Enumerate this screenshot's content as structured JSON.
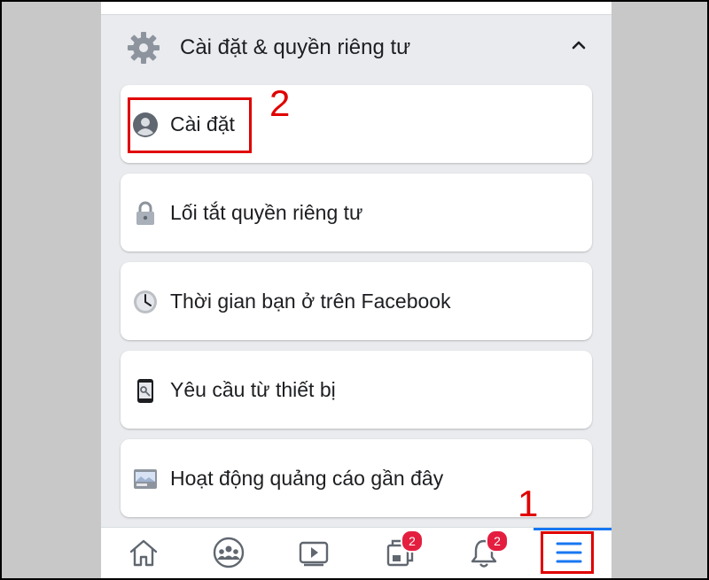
{
  "section": {
    "title": "Cài đặt & quyền riêng tư",
    "icon": "gear-icon",
    "collapse_icon": "chevron-up-icon"
  },
  "menu": [
    {
      "label": "Cài đặt",
      "icon": "user-avatar-icon"
    },
    {
      "label": "Lối tắt quyền riêng tư",
      "icon": "lock-icon"
    },
    {
      "label": "Thời gian bạn ở trên Facebook",
      "icon": "clock-icon"
    },
    {
      "label": "Yêu cầu từ thiết bị",
      "icon": "phone-key-icon"
    },
    {
      "label": "Hoạt động quảng cáo gần đây",
      "icon": "ad-activity-icon"
    }
  ],
  "tabbar": {
    "tabs": [
      {
        "name": "home",
        "icon": "home-icon"
      },
      {
        "name": "groups",
        "icon": "groups-icon"
      },
      {
        "name": "watch",
        "icon": "video-icon"
      },
      {
        "name": "pages",
        "icon": "pages-icon",
        "badge": "2"
      },
      {
        "name": "notifications",
        "icon": "bell-icon",
        "badge": "2"
      },
      {
        "name": "menu",
        "icon": "hamburger-menu-icon",
        "active": true
      }
    ]
  },
  "annotations": {
    "step1": "1",
    "step2": "2"
  },
  "colors": {
    "accent": "#1877f2",
    "badge": "#e41e3f",
    "annotation": "#e00000",
    "background": "#e9ebee"
  }
}
